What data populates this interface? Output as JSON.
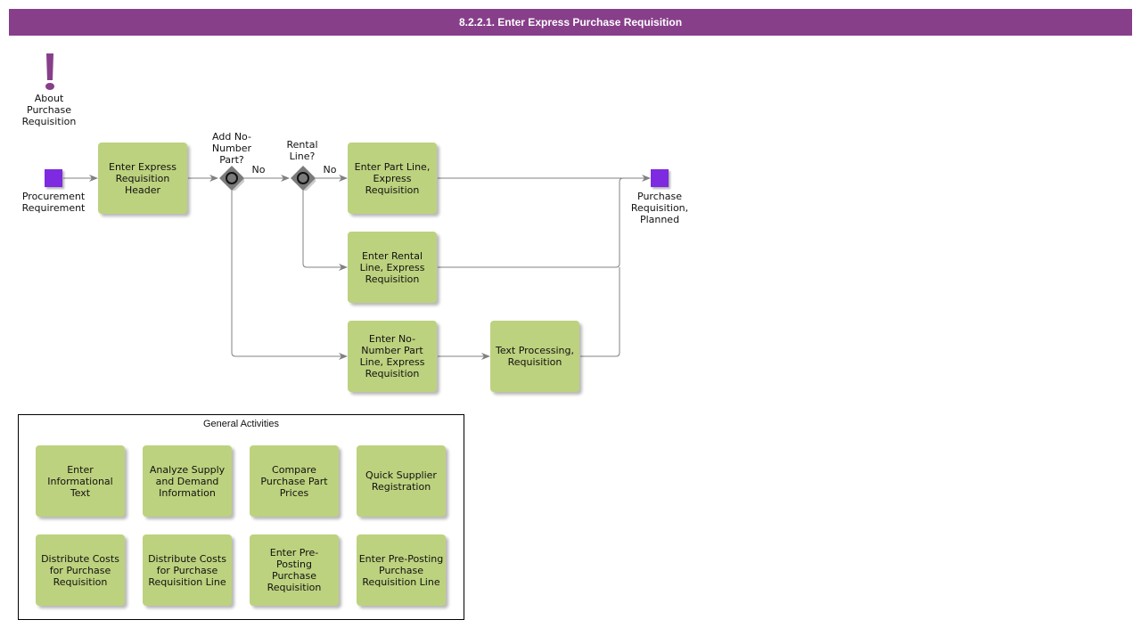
{
  "title": "8.2.2.1. Enter Express Purchase Requisition",
  "info": {
    "icon": "exclamation-icon",
    "label": "About Purchase Requisition",
    "color": "#873f8a"
  },
  "events": {
    "start": {
      "label": "Procurement Requirement",
      "color": "#7d2ae0"
    },
    "end": {
      "label": "Purchase Requisition, Planned",
      "color": "#7d2ae0"
    }
  },
  "gateways": [
    {
      "label": "Add No-Number Part?",
      "no_label": "No"
    },
    {
      "label": "Rental Line?",
      "no_label": "No"
    }
  ],
  "tasks": {
    "header": "Enter Express Requisition Header",
    "part_line": "Enter Part Line, Express Requisition",
    "rental_line": "Enter Rental Line, Express Requisition",
    "no_number_line": "Enter No-Number Part Line, Express Requisition",
    "text_processing": "Text Processing, Requisition"
  },
  "general_activities": {
    "title": "General Activities",
    "items": [
      "Enter Informational Text",
      "Analyze Supply and Demand Information",
      "Compare Purchase Part Prices",
      "Quick Supplier Registration",
      "Distribute Costs for Purchase Requisition",
      "Distribute Costs for Purchase Requisition Line",
      "Enter Pre-Posting Purchase Requisition",
      "Enter Pre-Posting Purchase Requisition Line"
    ]
  },
  "colors": {
    "task_fill": "#bdd27e",
    "gateway_fill": "#7a7a7a",
    "flow_line": "#808080",
    "banner": "#873f8a"
  }
}
